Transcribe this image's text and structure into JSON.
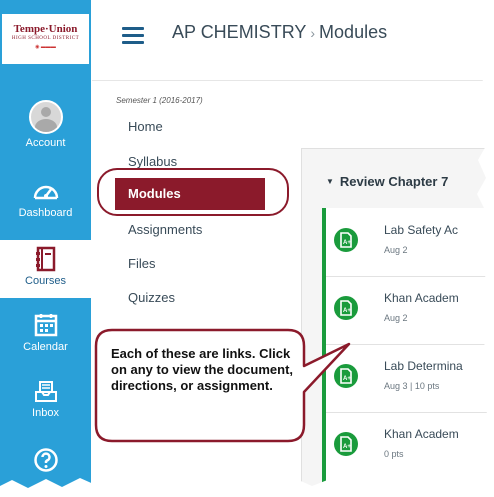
{
  "global_nav": {
    "logo": {
      "name": "Tempe·Union",
      "tagline": "HIGH SCHOOL DISTRICT"
    },
    "items": [
      {
        "label": "Account",
        "icon": "account-avatar-icon"
      },
      {
        "label": "Dashboard",
        "icon": "dashboard-gauge-icon"
      },
      {
        "label": "Courses",
        "icon": "courses-book-icon",
        "active": true
      },
      {
        "label": "Calendar",
        "icon": "calendar-icon"
      },
      {
        "label": "Inbox",
        "icon": "inbox-icon"
      },
      {
        "label": "",
        "icon": "help-icon"
      }
    ]
  },
  "header": {
    "course": "AP CHEMISTRY",
    "separator": "›",
    "page": "Modules"
  },
  "course_nav": {
    "term": "Semester 1 (2016-2017)",
    "items": [
      {
        "label": "Home"
      },
      {
        "label": "Syllabus"
      },
      {
        "label": "Modules",
        "active": true
      },
      {
        "label": "Assignments"
      },
      {
        "label": "Files"
      },
      {
        "label": "Quizzes"
      }
    ]
  },
  "module": {
    "title": "Review Chapter 7",
    "collapse_icon": "triangle-down-icon",
    "items": [
      {
        "title": "Lab Safety Ac",
        "meta": "Aug 2"
      },
      {
        "title": "Khan Academ",
        "meta": "Aug 2"
      },
      {
        "title": "Lab Determina",
        "meta": "Aug 3  |  10 pts"
      },
      {
        "title": "Khan Academ",
        "meta": "0 pts"
      }
    ]
  },
  "callout": {
    "text": "Each of these are links. Click on any to view the document, directions, or assignment."
  },
  "colors": {
    "nav_blue": "#2aa0d8",
    "course_accent": "#8b1a2b",
    "module_green": "#1a9b3c",
    "header_blue": "#1e5d89"
  }
}
